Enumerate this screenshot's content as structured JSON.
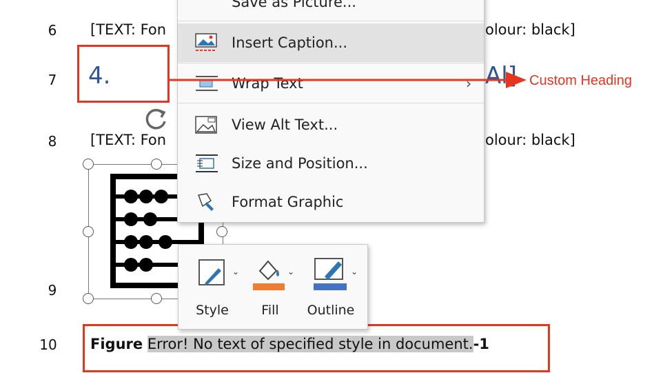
{
  "document": {
    "line_numbers": [
      "6",
      "7",
      "8",
      "9",
      "10"
    ],
    "line6_left": "[TEXT: Fon",
    "line6_right": "olour: black]",
    "line7_heading": "4.",
    "line7_tail": "Al]",
    "line8_left": "[TEXT: Fon",
    "line8_right": "olour: black]",
    "caption_bold": "Figure",
    "caption_error": "Error! No text of specified style in document.",
    "caption_suffix": "-1"
  },
  "annotation": {
    "label": "Custom Heading",
    "color": "#e8361e"
  },
  "context_menu": {
    "items": [
      {
        "label": "Save as Picture...",
        "icon": "save-picture-icon"
      },
      {
        "label": "Insert Caption...",
        "icon": "insert-caption-icon",
        "hover": true
      },
      {
        "label": "Wrap Text",
        "icon": "wrap-text-icon",
        "submenu": true
      },
      {
        "label": "View Alt Text...",
        "icon": "alt-text-icon"
      },
      {
        "label": "Size and Position...",
        "icon": "size-position-icon"
      },
      {
        "label": "Format Graphic",
        "icon": "format-graphic-icon"
      }
    ]
  },
  "mini_toolbar": {
    "buttons": [
      {
        "label": "Style",
        "icon": "style-icon"
      },
      {
        "label": "Fill",
        "icon": "fill-bucket-icon",
        "color": "#ed7d31"
      },
      {
        "label": "Outline",
        "icon": "outline-pen-icon",
        "color": "#4472c4"
      }
    ]
  },
  "colors": {
    "heading_blue": "#2f5597",
    "annotation_red": "#e8361e",
    "menu_bg": "#f9f9f9",
    "menu_hover": "#e2e2e2"
  }
}
